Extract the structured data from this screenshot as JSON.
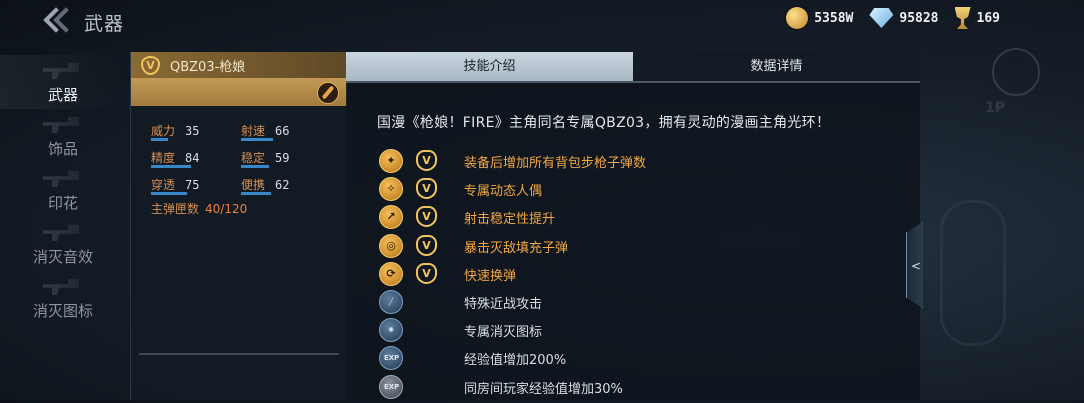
{
  "header": {
    "title": "武器",
    "currencies": [
      {
        "icon": "gold-coin-icon",
        "value": "5358W"
      },
      {
        "icon": "diamond-icon",
        "value": "95828"
      },
      {
        "icon": "trophy-icon",
        "value": "169"
      }
    ]
  },
  "sidebar": {
    "items": [
      {
        "label": "武器",
        "active": true
      },
      {
        "label": "饰品",
        "active": false
      },
      {
        "label": "印花",
        "active": false
      },
      {
        "label": "消灭音效",
        "active": false
      },
      {
        "label": "消灭图标",
        "active": false
      }
    ]
  },
  "weapon": {
    "rank_badge": "V",
    "name": "QBZ03-枪娘",
    "stats": [
      {
        "label": "威力",
        "value": "35",
        "level": 35
      },
      {
        "label": "射速",
        "value": "66",
        "level": 66
      },
      {
        "label": "精度",
        "value": "84",
        "level": 84
      },
      {
        "label": "稳定",
        "value": "59",
        "level": 59
      },
      {
        "label": "穿透",
        "value": "75",
        "level": 75
      },
      {
        "label": "便携",
        "value": "62",
        "level": 62
      }
    ],
    "ammo_label": "主弹匣数",
    "ammo_value": "40/120"
  },
  "tabs": [
    {
      "label": "技能介绍",
      "active": true
    },
    {
      "label": "数据详情",
      "active": false
    }
  ],
  "description": "国漫《枪娘！FIRE》主角同名专属QBZ03，拥有灵动的漫画主角光环！",
  "skills": [
    {
      "icon": "ammo-icon",
      "style": "gold",
      "rank": "V",
      "text": "装备后增加所有背包步枪子弹数"
    },
    {
      "icon": "doll-icon",
      "style": "gold",
      "rank": "V",
      "text": "专属动态人偶"
    },
    {
      "icon": "stability-icon",
      "style": "gold",
      "rank": "V",
      "text": "射击稳定性提升"
    },
    {
      "icon": "refill-icon",
      "style": "gold",
      "rank": "V",
      "text": "暴击灭敌填充子弹"
    },
    {
      "icon": "reload-icon",
      "style": "gold",
      "rank": "V",
      "text": "快速换弹"
    },
    {
      "icon": "melee-icon",
      "style": "blue",
      "rank": "",
      "text": "特殊近战攻击"
    },
    {
      "icon": "kill-icon",
      "style": "blue",
      "rank": "",
      "text": "专属消灭图标"
    },
    {
      "icon": "exp-icon",
      "style": "blue",
      "rank": "",
      "text": "经验值增加200%"
    },
    {
      "icon": "exp-room-icon",
      "style": "grey",
      "rank": "",
      "text": "同房间玩家经验值增加30%"
    }
  ],
  "right_side": {
    "mode_label": "1P",
    "toggle_glyph": "<"
  }
}
